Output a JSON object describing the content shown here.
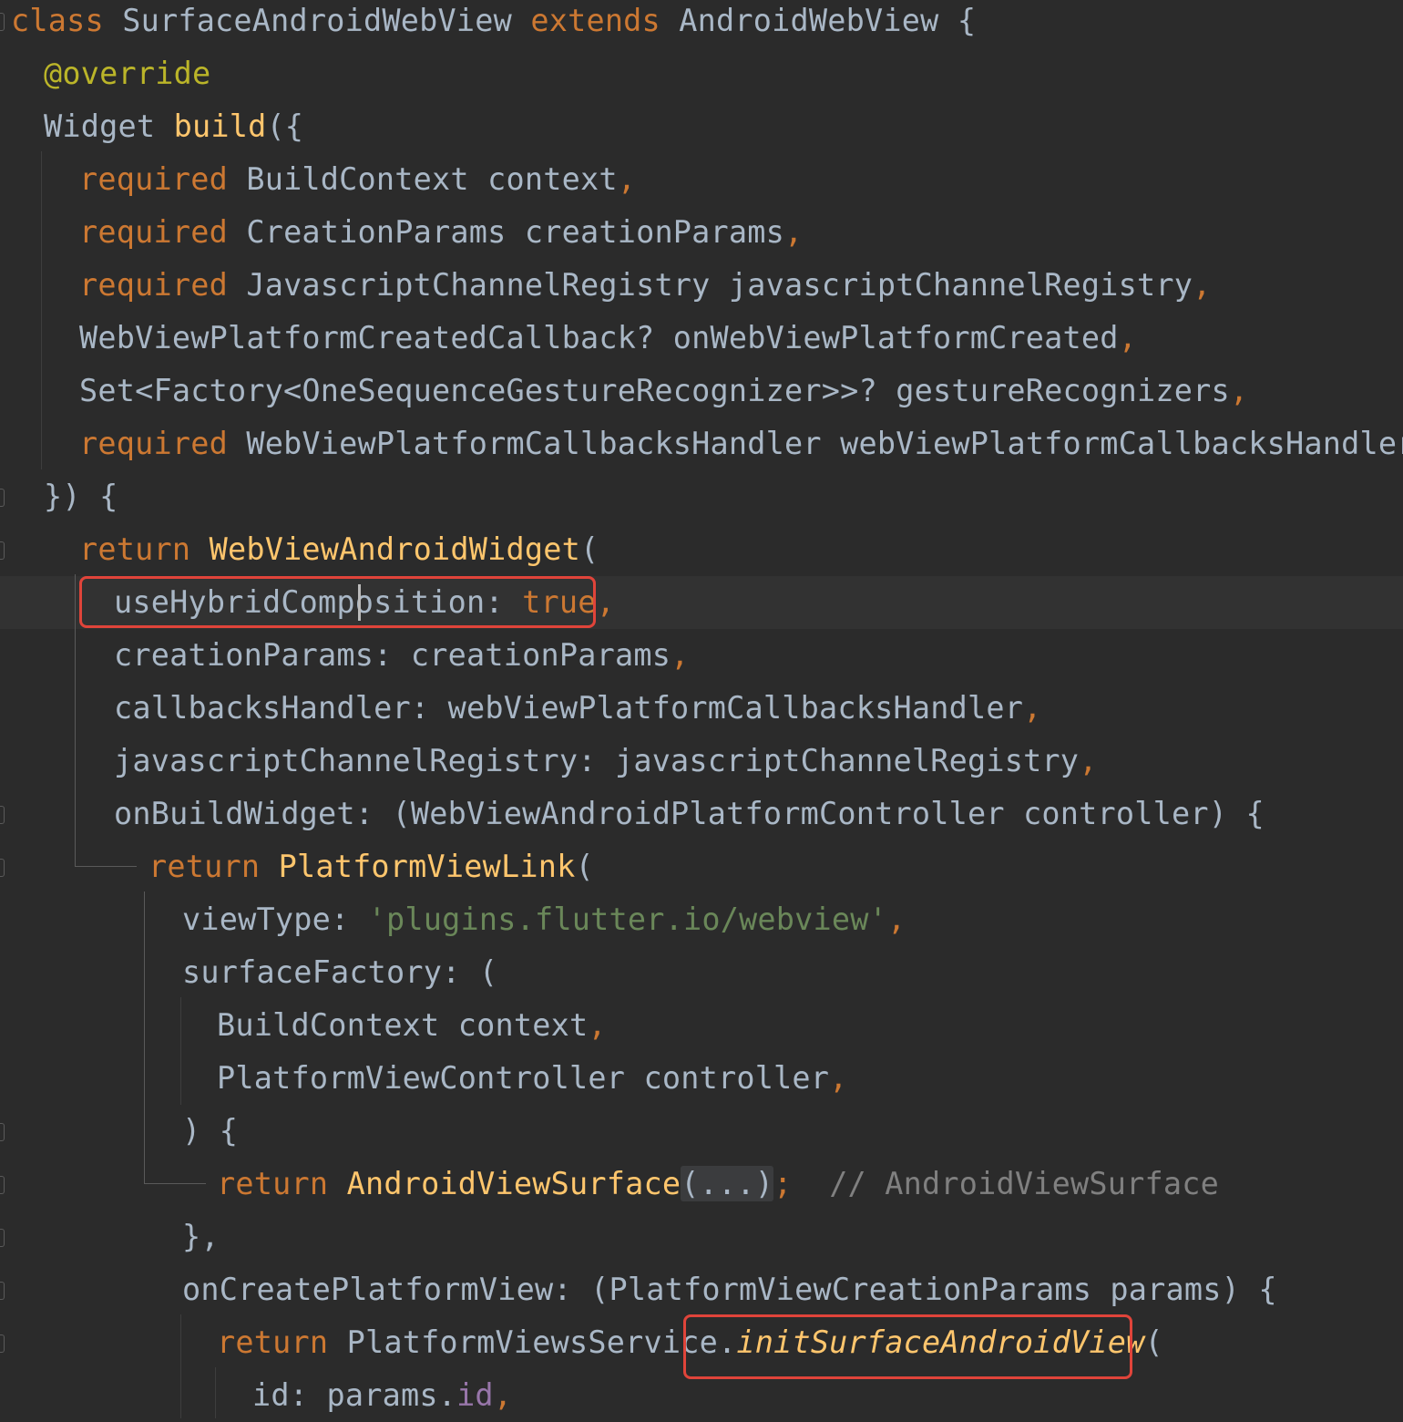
{
  "editor": {
    "lines": [
      [
        {
          "t": "class ",
          "c": "kw"
        },
        {
          "t": "SurfaceAndroidWebView ",
          "c": ""
        },
        {
          "t": "extends ",
          "c": "kw"
        },
        {
          "t": "AndroidWebView {",
          "c": ""
        }
      ],
      [
        {
          "t": "@override",
          "c": "ann"
        }
      ],
      [
        {
          "t": "Widget ",
          "c": ""
        },
        {
          "t": "build",
          "c": "fn"
        },
        {
          "t": "({",
          "c": ""
        }
      ],
      [
        {
          "t": "required ",
          "c": "kw"
        },
        {
          "t": "BuildContext context",
          "c": ""
        },
        {
          "t": ",",
          "c": "kw"
        }
      ],
      [
        {
          "t": "required ",
          "c": "kw"
        },
        {
          "t": "CreationParams creationParams",
          "c": ""
        },
        {
          "t": ",",
          "c": "kw"
        }
      ],
      [
        {
          "t": "required ",
          "c": "kw"
        },
        {
          "t": "JavascriptChannelRegistry javascriptChannelRegistry",
          "c": ""
        },
        {
          "t": ",",
          "c": "kw"
        }
      ],
      [
        {
          "t": "WebViewPlatformCreatedCallback? onWebViewPlatformCreated",
          "c": ""
        },
        {
          "t": ",",
          "c": "kw"
        }
      ],
      [
        {
          "t": "Set<Factory<OneSequenceGestureRecognizer>>? gestureRecognizers",
          "c": ""
        },
        {
          "t": ",",
          "c": "kw"
        }
      ],
      [
        {
          "t": "required ",
          "c": "kw"
        },
        {
          "t": "WebViewPlatformCallbacksHandler webViewPlatformCallbacksHandler",
          "c": ""
        },
        {
          "t": ",",
          "c": "kw"
        }
      ],
      [
        {
          "t": "}) {",
          "c": ""
        }
      ],
      [
        {
          "t": "return ",
          "c": "kw"
        },
        {
          "t": "WebViewAndroidWidget",
          "c": "fn"
        },
        {
          "t": "(",
          "c": ""
        }
      ],
      [
        {
          "t": "useHybridComposition: ",
          "c": ""
        },
        {
          "t": "true,",
          "c": "kw"
        }
      ],
      [
        {
          "t": "creationParams: creationParams",
          "c": ""
        },
        {
          "t": ",",
          "c": "kw"
        }
      ],
      [
        {
          "t": "callbacksHandler: webViewPlatformCallbacksHandler",
          "c": ""
        },
        {
          "t": ",",
          "c": "kw"
        }
      ],
      [
        {
          "t": "javascriptChannelRegistry: javascriptChannelRegistry",
          "c": ""
        },
        {
          "t": ",",
          "c": "kw"
        }
      ],
      [
        {
          "t": "onBuildWidget: (WebViewAndroidPlatformController controller) {",
          "c": ""
        }
      ],
      [
        {
          "t": "return ",
          "c": "kw"
        },
        {
          "t": "PlatformViewLink",
          "c": "fn"
        },
        {
          "t": "(",
          "c": ""
        }
      ],
      [
        {
          "t": "viewType: ",
          "c": ""
        },
        {
          "t": "'plugins.flutter.io/webview'",
          "c": "str"
        },
        {
          "t": ",",
          "c": "kw"
        }
      ],
      [
        {
          "t": "surfaceFactory: (",
          "c": ""
        }
      ],
      [
        {
          "t": "BuildContext context",
          "c": ""
        },
        {
          "t": ",",
          "c": "kw"
        }
      ],
      [
        {
          "t": "PlatformViewController controller",
          "c": ""
        },
        {
          "t": ",",
          "c": "kw"
        }
      ],
      [
        {
          "t": ") {",
          "c": ""
        }
      ],
      [
        {
          "t": "return ",
          "c": "kw"
        },
        {
          "t": "AndroidViewSurface",
          "c": "fn"
        },
        {
          "t": "(...)",
          "c": "fold"
        },
        {
          "t": ";",
          "c": "kw"
        },
        {
          "t": "  // AndroidViewSurface",
          "c": "cmt"
        }
      ],
      [
        {
          "t": "},",
          "c": ""
        }
      ],
      [
        {
          "t": "onCreatePlatformView: (PlatformViewCreationParams params) {",
          "c": ""
        }
      ],
      [
        {
          "t": "return ",
          "c": "kw"
        },
        {
          "t": "PlatformViewsService",
          "c": ""
        },
        {
          "t": ".",
          "c": ""
        },
        {
          "t": "initSurfaceAndroidView",
          "c": "fn it"
        },
        {
          "t": "(",
          "c": ""
        }
      ],
      [
        {
          "t": "id: params.",
          "c": ""
        },
        {
          "t": "id",
          "c": "field"
        },
        {
          "t": ",",
          "c": "kw"
        }
      ]
    ]
  },
  "colors": {
    "background": "#2b2b2b",
    "keyword": "#cc7832",
    "function": "#ffc66d",
    "annotation": "#bbb529",
    "string": "#6a8759",
    "comment": "#808080",
    "field": "#9876aa",
    "default": "#a9b7c6",
    "highlight_box": "#e0443a"
  }
}
